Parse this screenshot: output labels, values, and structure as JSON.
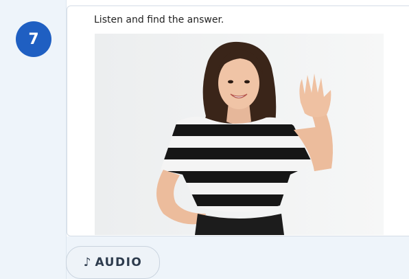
{
  "question": {
    "number": "7",
    "instruction": "Listen and find the answer.",
    "image_alt": "woman-waving-photo"
  },
  "audio": {
    "icon": "♪",
    "label": "AUDIO"
  },
  "colors": {
    "badge": "#1f5fc2",
    "rail": "#eef4fa",
    "audio_bg": "#eef3f8"
  }
}
